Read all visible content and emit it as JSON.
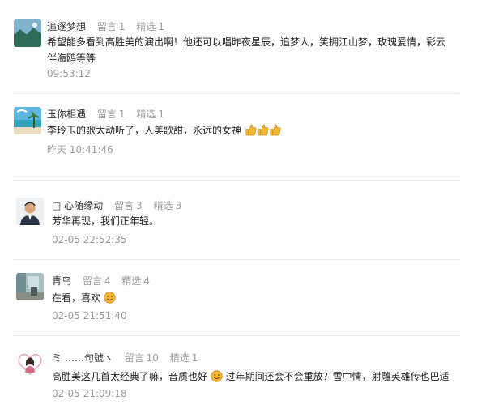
{
  "comments": [
    {
      "nickname": "追逐梦想",
      "replies_label": "留言",
      "replies": "1",
      "picks_label": "精选",
      "picks": "1",
      "text": "希望能多看到高胜美的演出啊！他还可以唱昨夜星辰，追梦人，笑拥江山梦，玫瑰爱情，彩云伴海鸥等等",
      "time": "09:53:12",
      "avatar_icon": "landscape-avatar-icon"
    },
    {
      "nickname": "玉你相遇",
      "replies_label": "留言",
      "replies": "1",
      "picks_label": "精选",
      "picks": "1",
      "text": "李玲玉的歌太动听了，人美歌甜，永远的女神",
      "time": "昨天 10:41:46",
      "avatar_icon": "beach-avatar-icon"
    },
    {
      "nickname": "□ 心随缘动",
      "replies_label": "留言",
      "replies": "3",
      "picks_label": "精选",
      "picks": "3",
      "text": "芳华再现，我们正年轻。",
      "time": "02-05 22:52:35",
      "avatar_icon": "person-avatar-icon"
    },
    {
      "nickname": "青鸟",
      "replies_label": "留言",
      "replies": "4",
      "picks_label": "精选",
      "picks": "4",
      "text": "在看，喜欢",
      "time": "02-05 21:51:40",
      "avatar_icon": "room-avatar-icon"
    },
    {
      "nickname": "ミ ……句號ヽ",
      "replies_label": "留言",
      "replies": "10",
      "picks_label": "精选",
      "picks": "1",
      "text": "高胜美这几首太经典了嘛，音质也好",
      "text2": "过年期间还会不会重放？雪中情，射雕英雄传也巴适",
      "time": "02-05 21:09:18",
      "avatar_icon": "heart-avatar-icon"
    }
  ],
  "colors": {
    "meta": "#9a9a9a",
    "divider": "#ececec",
    "emoji": "#f5b731"
  }
}
